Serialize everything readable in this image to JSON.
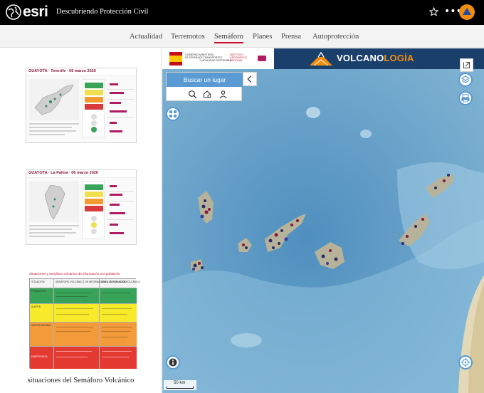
{
  "header": {
    "brand": "esri",
    "title": "Descubriendo Protección Civil"
  },
  "nav": {
    "items": [
      {
        "label": "Actualidad",
        "active": false
      },
      {
        "label": "Terremotos",
        "active": false
      },
      {
        "label": "Semáforo",
        "active": true
      },
      {
        "label": "Planes",
        "active": false
      },
      {
        "label": "Prensa",
        "active": false
      },
      {
        "label": "Autoprotección",
        "active": false
      }
    ]
  },
  "panel": {
    "cards": [
      {
        "title": "GUAYOTA · Tenerife · 06 marzo 2026"
      },
      {
        "title": "GUAYOTA · La Palma · 06 marzo 2026"
      }
    ],
    "semaforo_image_title": "Situaciones y Semáforo volcánico de información a la población",
    "semaforo_image_columns": [
      "SITUACIÓN",
      "SEMÁFORO VOLCÁNICO DE INFORMACIÓN A LA POBLACIÓN",
      "NIVEL DE ACTIVIDAD VOLCÁNICA"
    ],
    "semaforo_image_rows": [
      "PREALERTA",
      "ALERTA",
      "ALERTA MÁXIMA",
      "EMERGENCIA"
    ],
    "caption": "situaciones del Semáforo Volcánico"
  },
  "map": {
    "banner": {
      "gob_lines": [
        "GOBIERNO",
        "DE ESPAÑA"
      ],
      "ministry_lines": [
        "MINISTERIO",
        "DE TRANSPORTES",
        "Y MOVILIDAD SOSTENIBLE"
      ],
      "ign_lines": [
        "INSTITUTO",
        "GEOGRÁFICO",
        "NACIONAL"
      ],
      "title_a": "VOLCANO",
      "title_b": "LOGÍA"
    },
    "search": {
      "label": "Buscar un lugar"
    },
    "scale": "50 km",
    "colors": {
      "banner": "#1a3f6a",
      "accent": "#5a9bd3",
      "title_highlight": "#f28c0f"
    }
  }
}
